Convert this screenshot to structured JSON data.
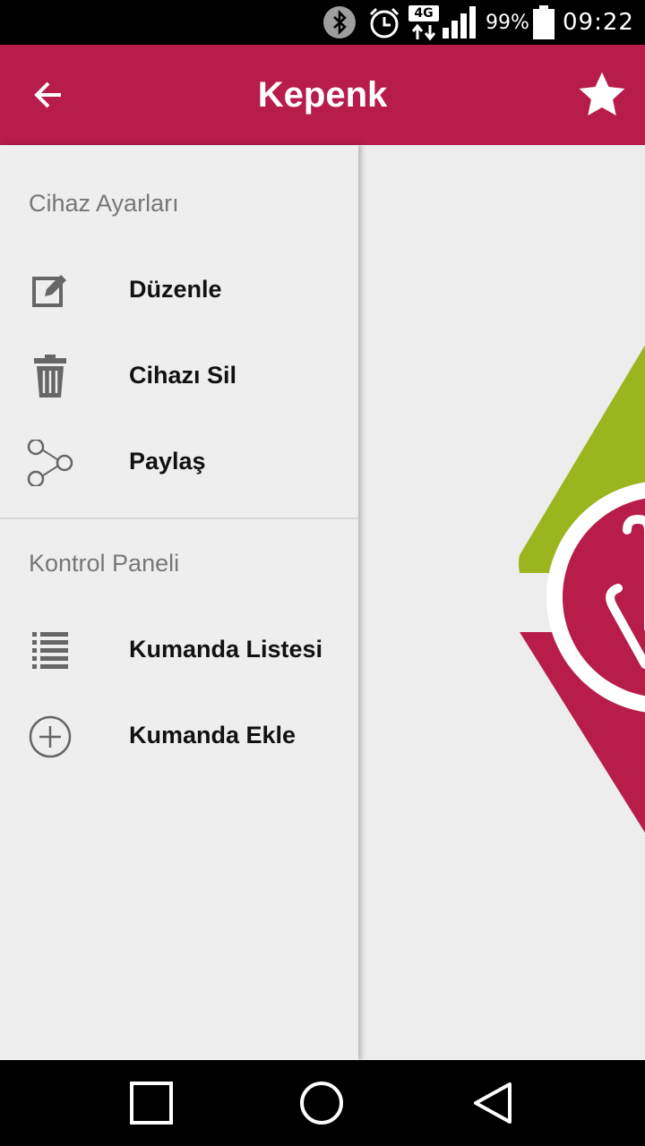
{
  "status_bar": {
    "network_type": "4G",
    "battery_percent": "99%",
    "time": "09:22",
    "icons": [
      "bluetooth-icon",
      "alarm-icon",
      "network-4g-icon",
      "signal-icon",
      "battery-icon"
    ]
  },
  "app_bar": {
    "title": "Kepenk",
    "back_icon": "arrow-back-icon",
    "favorite_icon": "star-icon"
  },
  "drawer": {
    "sections": [
      {
        "header": "Cihaz Ayarları",
        "items": [
          {
            "label": "Düzenle",
            "icon": "edit-icon"
          },
          {
            "label": "Cihazı Sil",
            "icon": "trash-icon"
          },
          {
            "label": "Paylaş",
            "icon": "share-icon"
          }
        ]
      },
      {
        "header": "Kontrol Paneli",
        "items": [
          {
            "label": "Kumanda Listesi",
            "icon": "list-icon"
          },
          {
            "label": "Kumanda Ekle",
            "icon": "add-circle-icon"
          }
        ]
      }
    ]
  },
  "colors": {
    "primary": "#b71c4b",
    "logo_green": "#9bb51e",
    "logo_red": "#b71c4b",
    "icon_gray": "#666666"
  },
  "nav_bar": {
    "icons": [
      "recent-apps-icon",
      "home-icon",
      "back-nav-icon"
    ]
  }
}
